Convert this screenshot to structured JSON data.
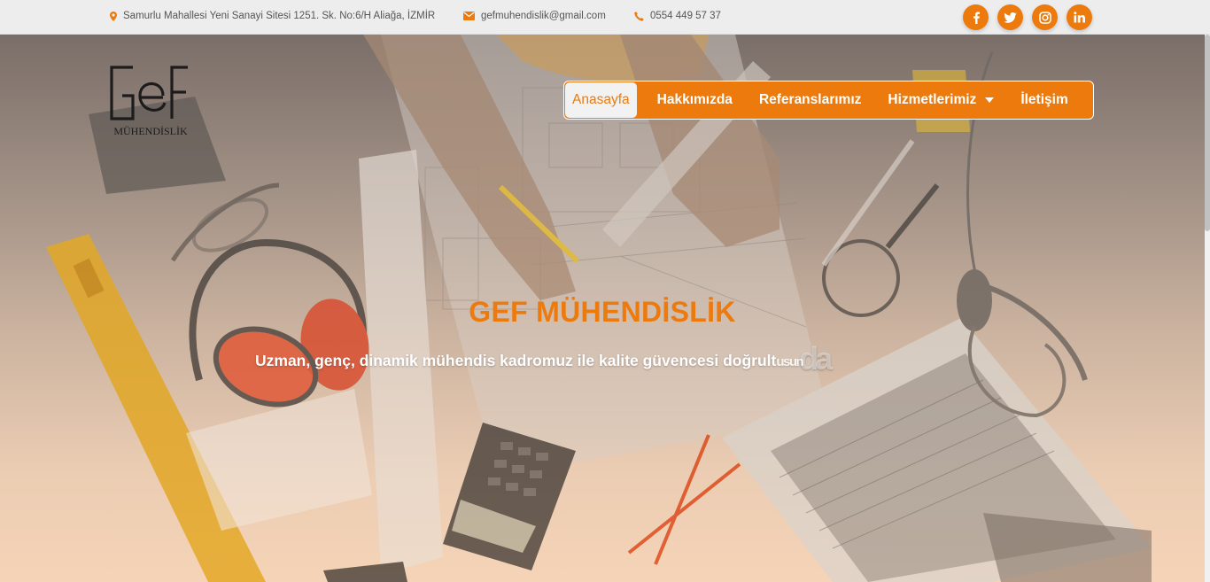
{
  "topbar": {
    "address": "Samurlu Mahallesi Yeni Sanayi Sitesi 1251. Sk. No:6/H Aliağa, İZMİR",
    "email": "gefmuhendislik@gmail.com",
    "phone": "0554 449 57 37",
    "icons": {
      "address": "map-marker-icon",
      "email": "envelope-icon",
      "phone": "phone-icon"
    }
  },
  "social": [
    "facebook-icon",
    "twitter-icon",
    "instagram-icon",
    "linkedin-icon"
  ],
  "logo": {
    "letters": "GEF",
    "subtitle": "MÜHENDİSLİK"
  },
  "nav": {
    "items": [
      {
        "label": "Anasayfa"
      },
      {
        "label": "Hakkımızda"
      },
      {
        "label": "Referanslarımız"
      },
      {
        "label": "Hizmetlerimiz"
      },
      {
        "label": "İletişim"
      }
    ],
    "active_index": 0,
    "dropdown_index": 3
  },
  "hero": {
    "title": "GEF MÜHENDİSLİK",
    "subtitle": "Uzman, genç, dinamik mühendis kadromuz ile kalite güvencesi doğrult",
    "subtitle_tail": "usun",
    "subtitle_ghost": "da"
  },
  "colors": {
    "accent": "#ec7a0d",
    "topbar_bg": "#ededed",
    "text_light": "#ffffff"
  }
}
